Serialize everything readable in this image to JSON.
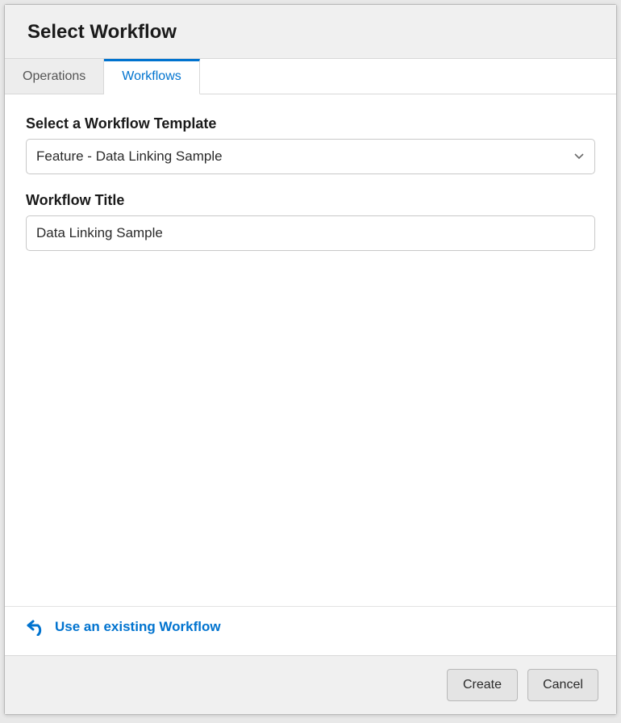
{
  "dialog": {
    "title": "Select Workflow"
  },
  "tabs": {
    "operations": "Operations",
    "workflows": "Workflows"
  },
  "form": {
    "template_label": "Select a Workflow Template",
    "template_value": "Feature - Data Linking Sample",
    "title_label": "Workflow Title",
    "title_value": "Data Linking Sample"
  },
  "existing_link": "Use an existing Workflow",
  "footer": {
    "create": "Create",
    "cancel": "Cancel"
  }
}
